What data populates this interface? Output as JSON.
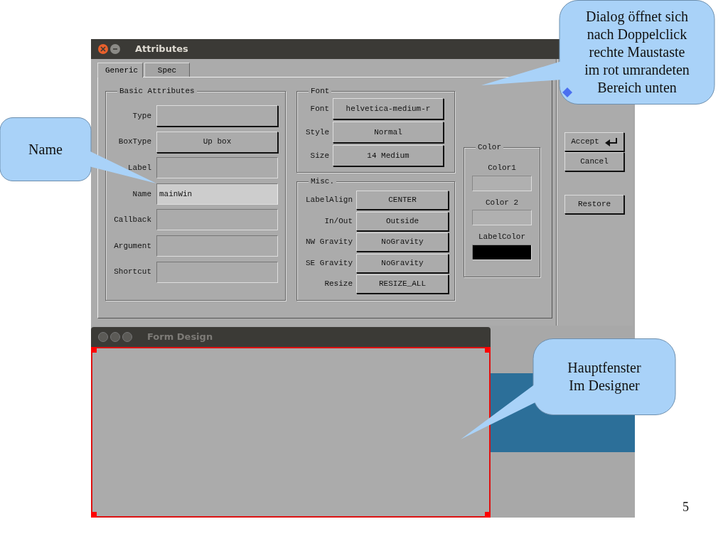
{
  "attributes_window": {
    "title": "Attributes",
    "tabs": [
      {
        "label": "Generic",
        "selected": true
      },
      {
        "label": "Spec",
        "selected": false
      }
    ],
    "basic_attributes": {
      "title": "Basic Attributes",
      "rows": [
        {
          "label": "Type",
          "kind": "choice"
        },
        {
          "label": "BoxType",
          "kind": "choice",
          "value": "Up box"
        },
        {
          "label": "Label",
          "kind": "input",
          "focused": false
        },
        {
          "label": "Name",
          "kind": "input",
          "value": "mainWin",
          "focused": true
        },
        {
          "label": "Callback",
          "kind": "input",
          "focused": false
        },
        {
          "label": "Argument",
          "kind": "input",
          "focused": false
        },
        {
          "label": "Shortcut",
          "kind": "input",
          "focused": false
        }
      ]
    },
    "font": {
      "title": "Font",
      "rows": [
        {
          "label": "Font",
          "value": "helvetica-medium-r"
        },
        {
          "label": "Style",
          "value": "Normal"
        },
        {
          "label": "Size",
          "value": "14  Medium"
        }
      ]
    },
    "misc": {
      "title": "Misc.",
      "rows": [
        {
          "label": "LabelAlign",
          "value": "CENTER"
        },
        {
          "label": "In/Out",
          "value": "Outside"
        },
        {
          "label": "NW Gravity",
          "value": "NoGravity"
        },
        {
          "label": "SE Gravity",
          "value": "NoGravity"
        },
        {
          "label": "Resize",
          "value": "RESIZE_ALL"
        }
      ]
    },
    "color": {
      "title": "Color",
      "swatches": [
        {
          "label": "Color1",
          "color": "#b0b0b0"
        },
        {
          "label": "Color 2",
          "color": "#b0b0b0"
        },
        {
          "label": "LabelColor",
          "color": "#000000"
        }
      ]
    },
    "buttons": [
      {
        "label": "Accept",
        "kind": "enter"
      },
      {
        "label": "Cancel",
        "kind": "plain"
      },
      {
        "label": "Restore",
        "kind": "plain"
      }
    ]
  },
  "form_design_window": {
    "title": "Form Design"
  },
  "callouts": [
    {
      "lines": [
        "Dialog öffnet sich",
        "nach Doppelclick",
        "rechte Maustaste",
        "im rot umrandeten",
        "Bereich unten"
      ]
    },
    {
      "lines": [
        "Name"
      ]
    },
    {
      "lines": [
        "Hauptfenster",
        "Im Designer"
      ]
    }
  ],
  "page_number": "5"
}
